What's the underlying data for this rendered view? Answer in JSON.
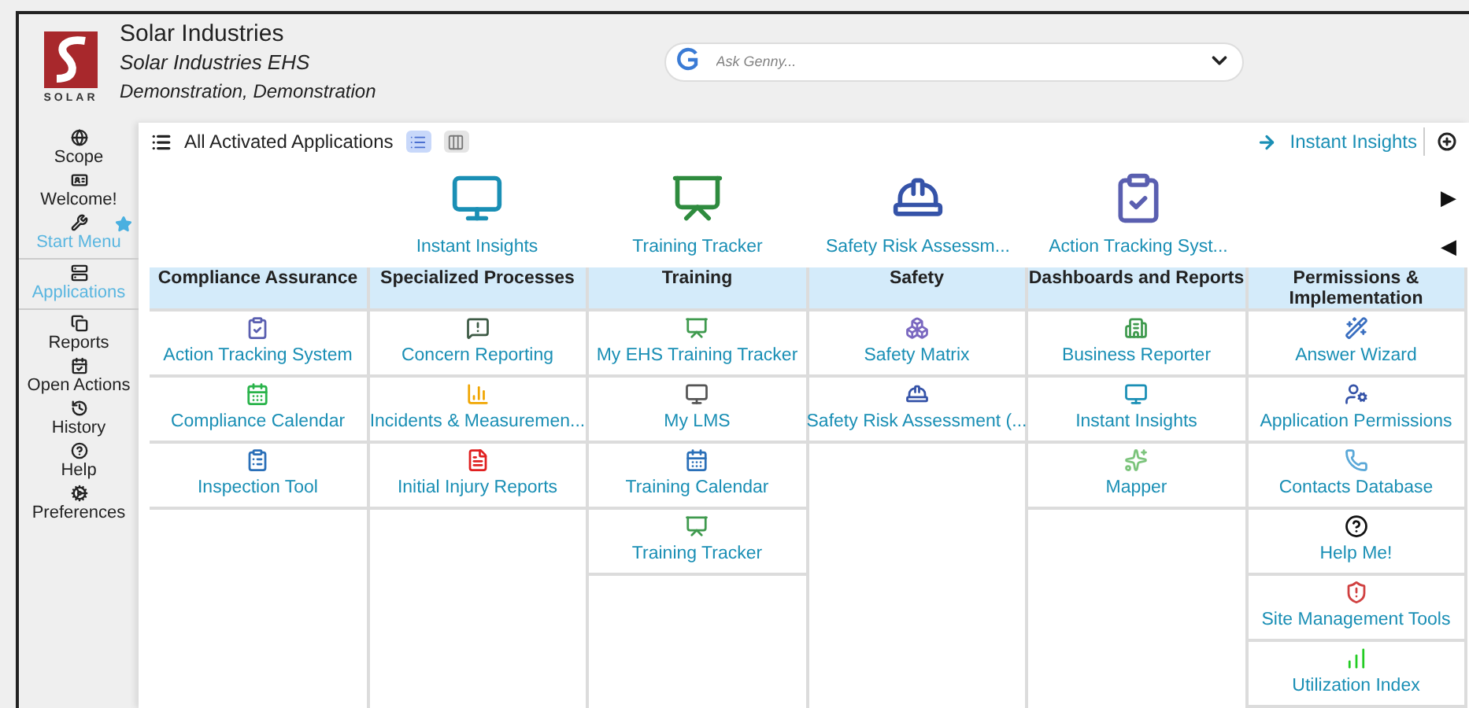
{
  "logo": {
    "text": "SOLAR"
  },
  "header": {
    "company": "Solar Industries",
    "app": "Solar Industries EHS",
    "user": "Demonstration, Demonstration"
  },
  "search": {
    "placeholder": "Ask Genny..."
  },
  "sidebar": {
    "items": [
      {
        "label": "Scope",
        "active": false,
        "starred": false
      },
      {
        "label": "Welcome!",
        "active": false,
        "starred": false
      },
      {
        "label": "Start Menu",
        "active": true,
        "starred": true
      },
      {
        "label": "Applications",
        "active": true,
        "starred": false
      },
      {
        "label": "Reports",
        "active": false,
        "starred": false
      },
      {
        "label": "Open Actions",
        "active": false,
        "starred": false
      },
      {
        "label": "History",
        "active": false,
        "starred": false
      },
      {
        "label": "Help",
        "active": false,
        "starred": false
      },
      {
        "label": "Preferences",
        "active": false,
        "starred": false
      }
    ]
  },
  "toolbar": {
    "title": "All Activated Applications",
    "views": [
      {
        "selected": true
      },
      {
        "selected": false
      }
    ],
    "link": "Instant Insights"
  },
  "featured": [
    "Instant Insights",
    "Training Tracker",
    "Safety Risk Assessm...",
    "Action Tracking Syst..."
  ],
  "carousel": {
    "next": "▶",
    "prev": "◀"
  },
  "columns": [
    {
      "title": "Compliance Assurance",
      "apps": [
        "Action Tracking System",
        "Compliance Calendar",
        "Inspection Tool"
      ]
    },
    {
      "title": "Specialized Processes",
      "apps": [
        "Concern Reporting",
        "Incidents & Measuremen...",
        "Initial Injury Reports"
      ]
    },
    {
      "title": "Training",
      "apps": [
        "My EHS Training Tracker",
        "My LMS",
        "Training Calendar",
        "Training Tracker"
      ]
    },
    {
      "title": "Safety",
      "apps": [
        "Safety Matrix",
        "Safety Risk Assessment (..."
      ]
    },
    {
      "title": "Dashboards and Reports",
      "apps": [
        "Business Reporter",
        "Instant Insights",
        "Mapper"
      ]
    },
    {
      "title": "Permissions & Implementation",
      "apps": [
        "Answer Wizard",
        "Application Permissions",
        "Contacts Database",
        "Help Me!",
        "Site Management Tools",
        "Utilization Index"
      ]
    }
  ]
}
